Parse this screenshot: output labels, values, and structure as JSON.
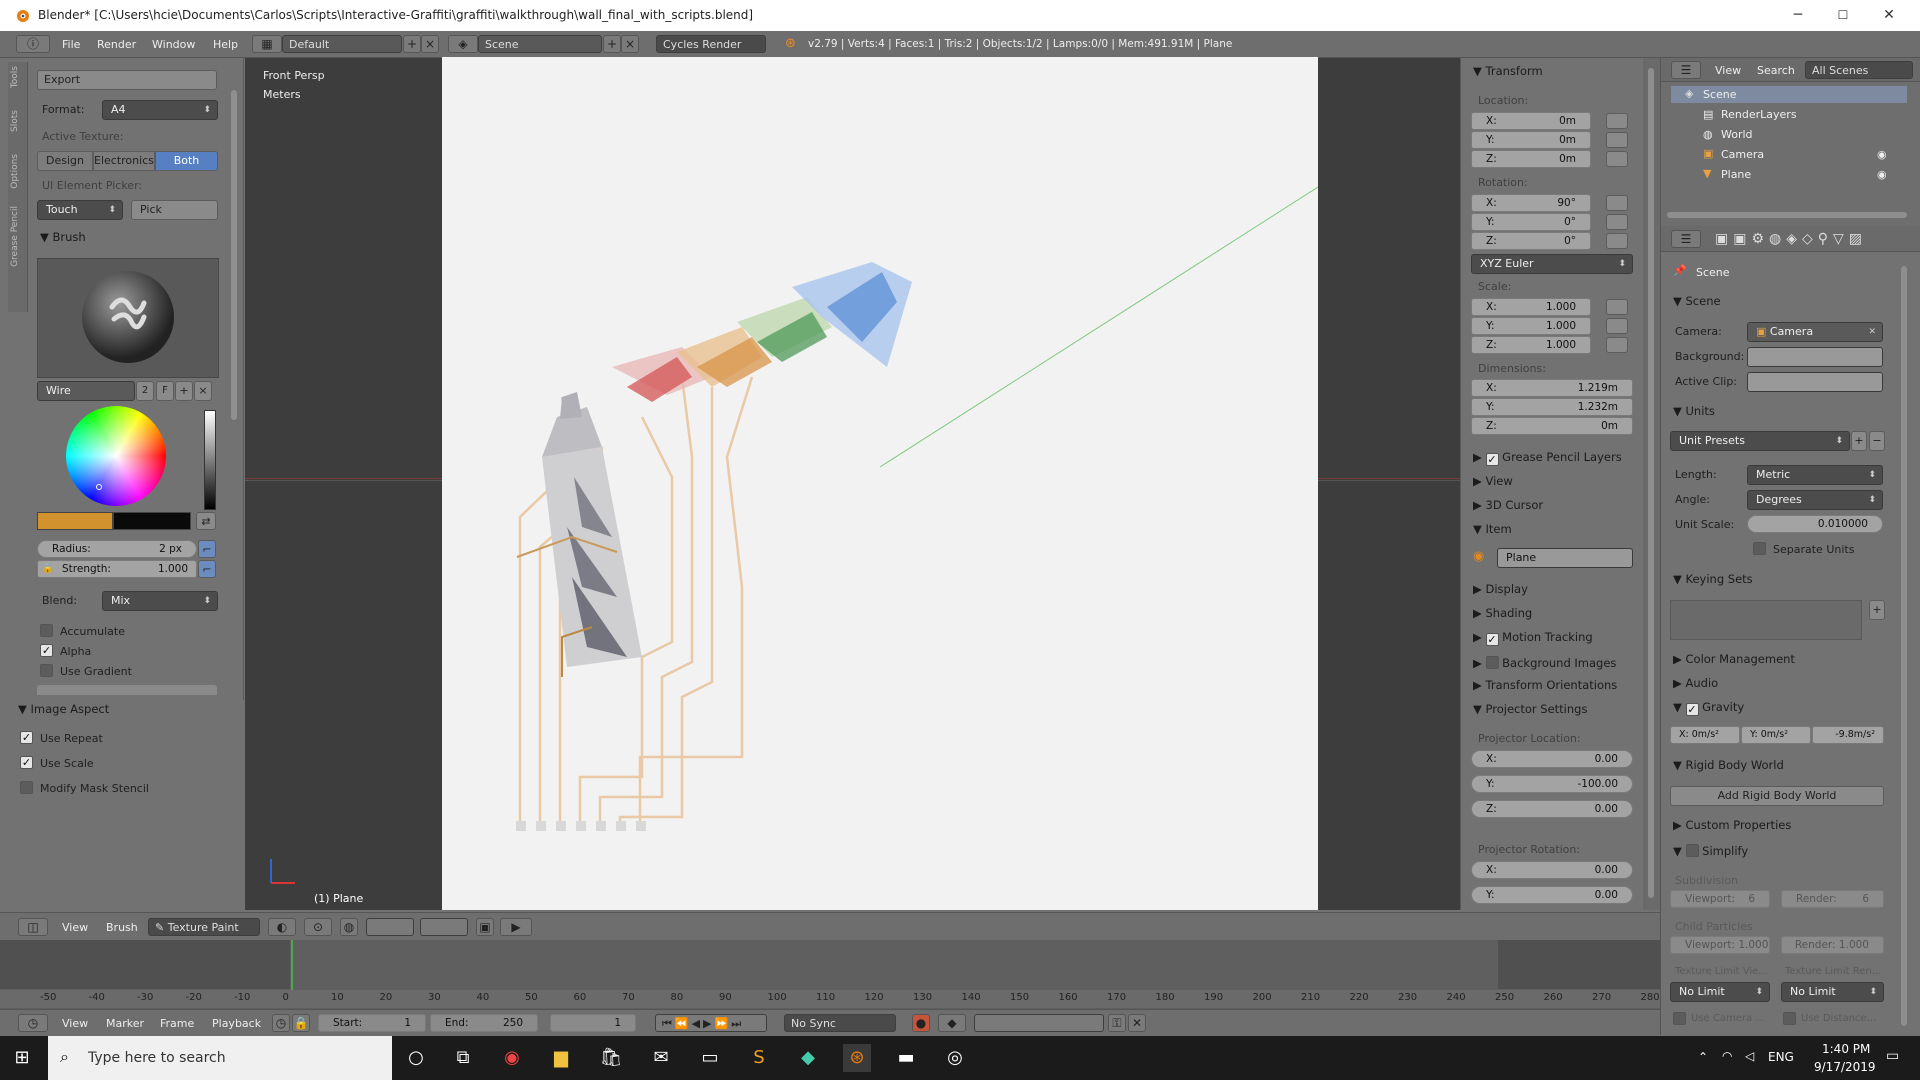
{
  "window": {
    "title": "Blender* [C:\\Users\\hcie\\Documents\\Carlos\\Scripts\\Interactive-Graffiti\\graffiti\\walkthrough\\wall_final_with_scripts.blend]",
    "minimize": "─",
    "maximize": "☐",
    "close": "✕"
  },
  "menubar": {
    "items": [
      "File",
      "Render",
      "Window",
      "Help"
    ],
    "layout": "Default",
    "scene": "Scene",
    "engine": "Cycles Render",
    "stats": "v2.79 | Verts:4 | Faces:1 | Tris:2 | Objects:1/2 | Lamps:0/0 | Mem:491.91M | Plane"
  },
  "vtabs": [
    "Tools",
    "Slots",
    "Options",
    "Grease Pencil"
  ],
  "tools": {
    "export": "Export",
    "format_label": "Format:",
    "format_value": "A4",
    "active_texture_label": "Active Texture:",
    "tex_buttons": [
      "Design",
      "Electronics",
      "Both"
    ],
    "picker_label": "UI Element Picker:",
    "touch": "Touch",
    "pick": "Pick",
    "brush_header": "Brush",
    "brush_name": "Wire",
    "brush_users": "2",
    "brush_f": "F",
    "radius_label": "Radius:",
    "radius_value": "2 px",
    "strength_label": "Strength:",
    "strength_value": "1.000",
    "blend_label": "Blend:",
    "blend_value": "Mix",
    "accumulate": "Accumulate",
    "alpha": "Alpha",
    "use_gradient": "Use Gradient",
    "image_aspect": "Image Aspect",
    "use_repeat": "Use Repeat",
    "use_scale": "Use Scale",
    "modify_mask": "Modify Mask Stencil",
    "primary_color": "#d2922e",
    "secondary_color": "#0a0a0a"
  },
  "viewport": {
    "view_name": "Front Persp",
    "units": "Meters",
    "object": "(1) Plane"
  },
  "npanel": {
    "transform": "Transform",
    "location": "Location:",
    "loc": [
      {
        "l": "X:",
        "v": "0m"
      },
      {
        "l": "Y:",
        "v": "0m"
      },
      {
        "l": "Z:",
        "v": "0m"
      }
    ],
    "rotation": "Rotation:",
    "rot": [
      {
        "l": "X:",
        "v": "90°"
      },
      {
        "l": "Y:",
        "v": "0°"
      },
      {
        "l": "Z:",
        "v": "0°"
      }
    ],
    "euler": "XYZ Euler",
    "scale": "Scale:",
    "scl": [
      {
        "l": "X:",
        "v": "1.000"
      },
      {
        "l": "Y:",
        "v": "1.000"
      },
      {
        "l": "Z:",
        "v": "1.000"
      }
    ],
    "dimensions": "Dimensions:",
    "dim": [
      {
        "l": "X:",
        "v": "1.219m"
      },
      {
        "l": "Y:",
        "v": "1.232m"
      },
      {
        "l": "Z:",
        "v": "0m"
      }
    ],
    "grease_pencil": "Grease Pencil Layers",
    "view": "View",
    "cursor": "3D Cursor",
    "item": "Item",
    "item_name": "Plane",
    "display": "Display",
    "shading": "Shading",
    "motion_tracking": "Motion Tracking",
    "background_images": "Background Images",
    "transform_orientations": "Transform Orientations",
    "projector_settings": "Projector Settings",
    "projector_location": "Projector Location:",
    "ploc": [
      {
        "l": "X:",
        "v": "0.00"
      },
      {
        "l": "Y:",
        "v": "-100.00"
      },
      {
        "l": "Z:",
        "v": "0.00"
      }
    ],
    "projector_rotation": "Projector Rotation:",
    "prot": [
      {
        "l": "X:",
        "v": "0.00"
      },
      {
        "l": "Y:",
        "v": "0.00"
      }
    ]
  },
  "outliner": {
    "view": "View",
    "search": "Search",
    "all_scenes": "All Scenes",
    "items": [
      "Scene",
      "RenderLayers",
      "World",
      "Camera",
      "Plane"
    ]
  },
  "props": {
    "scene_crumb": "Scene",
    "scene_header": "Scene",
    "camera_label": "Camera:",
    "camera_value": "Camera",
    "background_label": "Background:",
    "active_clip_label": "Active Clip:",
    "units_header": "Units",
    "unit_presets": "Unit Presets",
    "length_label": "Length:",
    "length_value": "Metric",
    "angle_label": "Angle:",
    "angle_value": "Degrees",
    "unit_scale_label": "Unit Scale:",
    "unit_scale_value": "0.010000",
    "separate_units": "Separate Units",
    "keying_sets": "Keying Sets",
    "color_management": "Color Management",
    "audio": "Audio",
    "gravity": "Gravity",
    "gravity_vals": [
      "X: 0m/s²",
      "Y: 0m/s²",
      "-9.8m/s²"
    ],
    "rigid_body_world": "Rigid Body World",
    "add_rigid_body": "Add Rigid Body World",
    "custom_properties": "Custom Properties",
    "simplify": "Simplify",
    "subdivision": "Subdivision",
    "viewport_label": "Viewport:",
    "viewport_val": "6",
    "render_label": "Render:",
    "render_val": "6",
    "child_particles": "Child Particles",
    "cp_viewport": "Viewport: 1.000",
    "cp_render": "Render: 1.000",
    "texture_limit_viewport": "Texture Limit Vie...",
    "texture_limit_render": "Texture Limit Ren...",
    "no_limit": "No Limit",
    "use_camera": "Use Camera ...",
    "use_distance": "Use Distance..."
  },
  "vpheader": {
    "view": "View",
    "brush": "Brush",
    "mode": "Texture Paint"
  },
  "timeline": {
    "ticks": [
      "-50",
      "-40",
      "-30",
      "-20",
      "-10",
      "0",
      "10",
      "20",
      "30",
      "40",
      "50",
      "60",
      "70",
      "80",
      "90",
      "100",
      "110",
      "120",
      "130",
      "140",
      "150",
      "160",
      "170",
      "180",
      "190",
      "200",
      "210",
      "220",
      "230",
      "240",
      "250",
      "260",
      "270",
      "280"
    ]
  },
  "tlheader": {
    "view": "View",
    "marker": "Marker",
    "frame": "Frame",
    "playback": "Playback",
    "start_label": "Start:",
    "start": "1",
    "end_label": "End:",
    "end": "250",
    "current": "1",
    "sync": "No Sync"
  },
  "taskbar": {
    "search": "Type here to search",
    "lang": "ENG",
    "time": "1:40 PM",
    "date": "9/17/2019"
  }
}
